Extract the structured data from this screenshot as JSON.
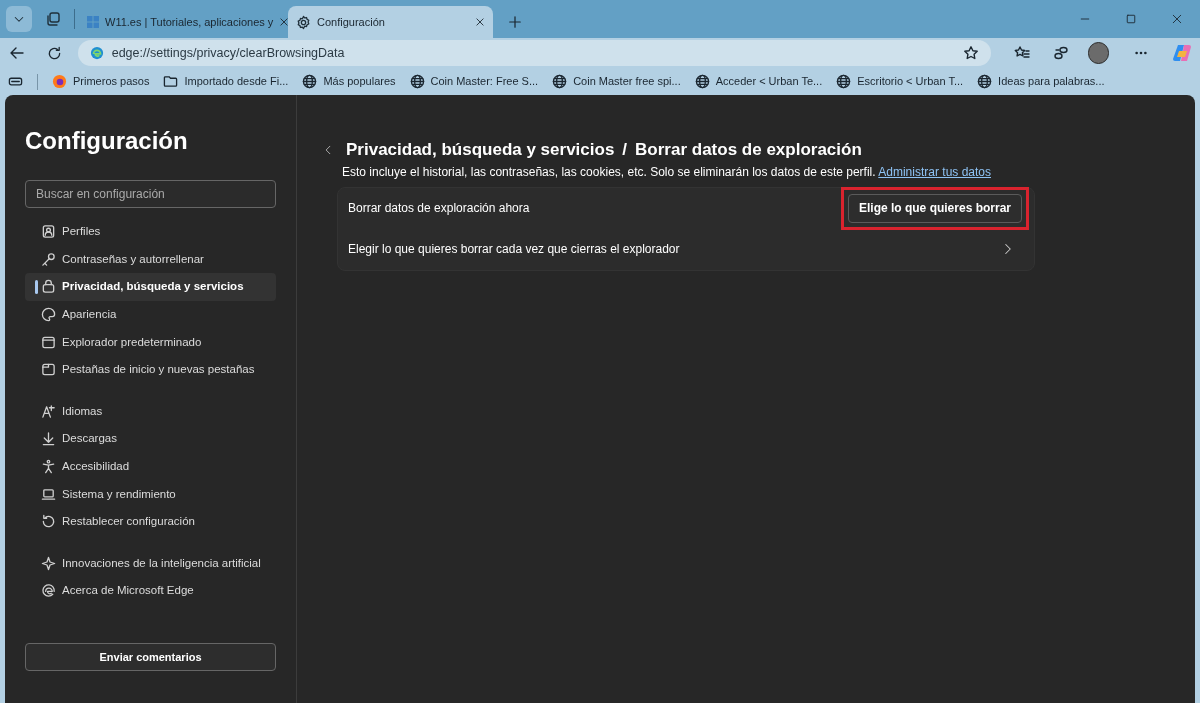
{
  "tabs": [
    {
      "title": "W11.es | Tutoriales, aplicaciones y",
      "selected": false
    },
    {
      "title": "Configuración",
      "selected": true
    }
  ],
  "address_bar": {
    "url": "edge://settings/privacy/clearBrowsingData"
  },
  "bookmarks": [
    {
      "label": "Primeros pasos",
      "kind": "browser"
    },
    {
      "label": "Importado desde Fi...",
      "kind": "folder"
    },
    {
      "label": "Más populares",
      "kind": "globe"
    },
    {
      "label": "Coin Master: Free S...",
      "kind": "globe"
    },
    {
      "label": "Coin Master free spi...",
      "kind": "globe"
    },
    {
      "label": "Acceder < Urban Te...",
      "kind": "globe"
    },
    {
      "label": "Escritorio < Urban T...",
      "kind": "globe"
    },
    {
      "label": "Ideas para palabras...",
      "kind": "globe"
    }
  ],
  "sidebar": {
    "title": "Configuración",
    "search_placeholder": "Buscar en configuración",
    "groups": [
      [
        {
          "label": "Perfiles",
          "selected": false
        },
        {
          "label": "Contraseñas y autorrellenar",
          "selected": false
        },
        {
          "label": "Privacidad, búsqueda y servicios",
          "selected": true
        },
        {
          "label": "Apariencia",
          "selected": false
        },
        {
          "label": "Explorador predeterminado",
          "selected": false
        },
        {
          "label": "Pestañas de inicio y nuevas pestañas",
          "selected": false
        }
      ],
      [
        {
          "label": "Idiomas",
          "selected": false
        },
        {
          "label": "Descargas",
          "selected": false
        },
        {
          "label": "Accesibilidad",
          "selected": false
        },
        {
          "label": "Sistema y rendimiento",
          "selected": false
        },
        {
          "label": "Restablecer configuración",
          "selected": false
        }
      ],
      [
        {
          "label": "Innovaciones de la inteligencia artificial",
          "selected": false
        },
        {
          "label": "Acerca de Microsoft Edge",
          "selected": false
        }
      ]
    ],
    "feedback_button": "Enviar comentarios"
  },
  "main": {
    "breadcrumb_parent": "Privacidad, búsqueda y servicios",
    "breadcrumb_separator": "/",
    "title": "Borrar datos de exploración",
    "description": "Esto incluye el historial, las contraseñas, las cookies, etc. Solo se eliminarán los datos de este perfil.",
    "description_link": "Administrar tus datos",
    "rows": [
      {
        "label": "Borrar datos de exploración ahora",
        "kind": "button",
        "button": "Elige lo que quieres borrar",
        "highlighted": true
      },
      {
        "label": "Elegir lo que quieres borrar cada vez que cierras el explorador",
        "kind": "chevron"
      }
    ]
  }
}
